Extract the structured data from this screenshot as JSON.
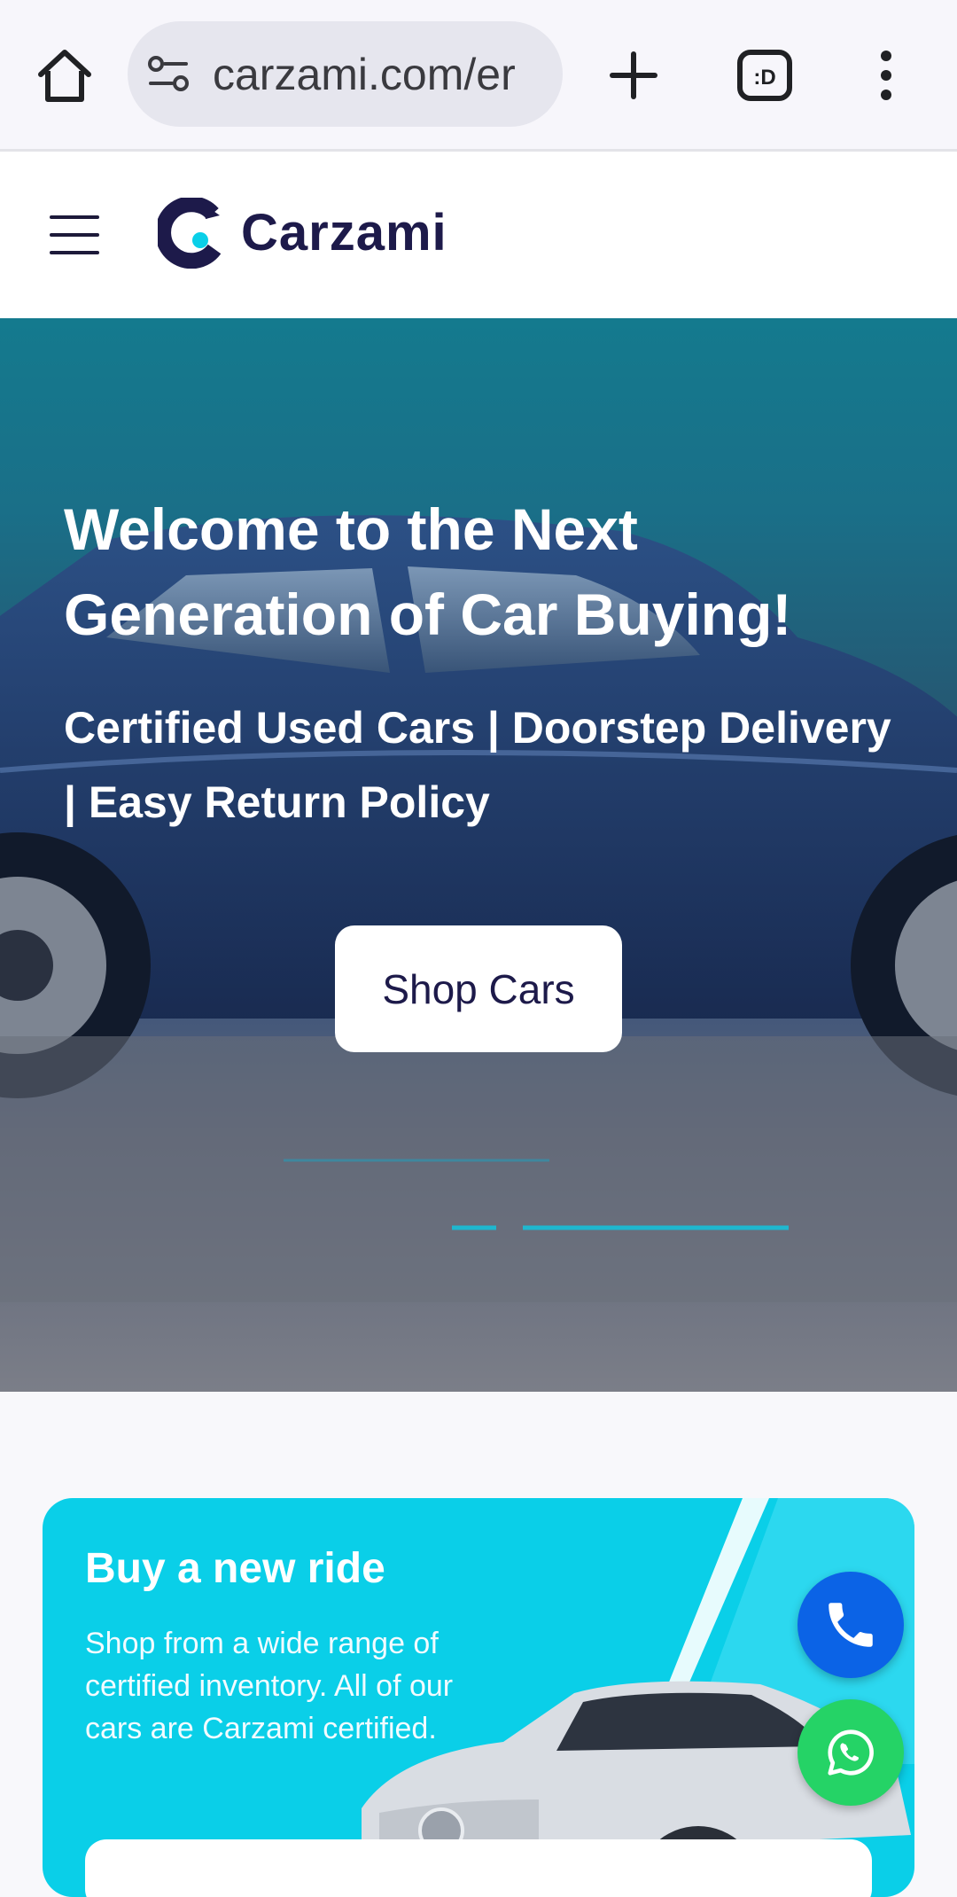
{
  "browser": {
    "url": "carzami.com/er",
    "tab_count_label": ":D"
  },
  "header": {
    "brand": "Carzami"
  },
  "hero": {
    "title": "Welcome to the Next Generation of Car Buying!",
    "subtitle": "Certified Used Cars | Doorstep Delivery | Easy Return Policy",
    "cta_label": "Shop Cars"
  },
  "buy_card": {
    "title": "Buy a new ride",
    "description": "Shop from a wide range of certified inventory. All of our cars are Carzami certified."
  },
  "icons": {
    "home": "home-icon",
    "site_info": "tune-icon",
    "new_tab": "plus-icon",
    "tabs": "tab-switcher-icon",
    "menu": "more-vert-icon",
    "nav": "hamburger-icon",
    "phone": "phone-icon",
    "whatsapp": "whatsapp-icon"
  },
  "colors": {
    "brand_navy": "#1d1a4a",
    "brand_cyan": "#0acfe8",
    "hero_teal": "#147a8e",
    "phone_blue": "#0b63e6",
    "whatsapp_green": "#25d366"
  }
}
